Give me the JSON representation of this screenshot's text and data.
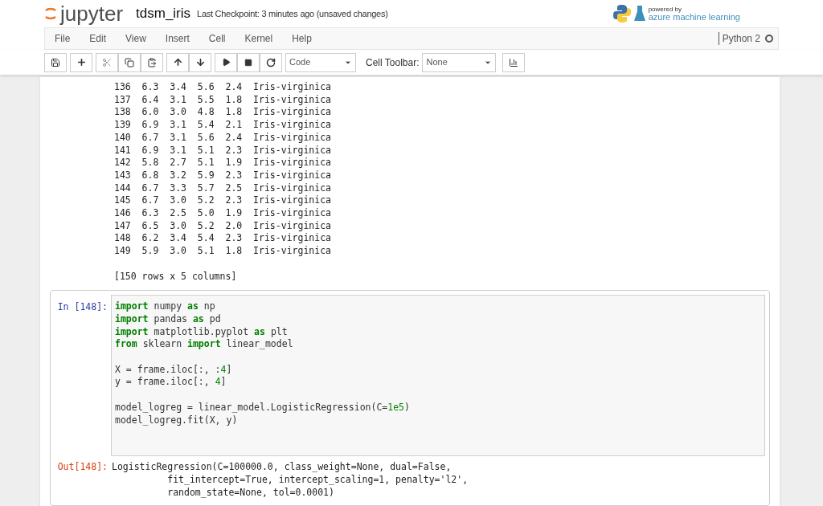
{
  "header": {
    "logo_text": "jupyter",
    "notebook_name": "tdsm_iris",
    "checkpoint": "Last Checkpoint: 3 minutes ago (unsaved changes)",
    "powered_by": "powered by",
    "brand": "azure machine learning"
  },
  "menu": [
    "File",
    "Edit",
    "View",
    "Insert",
    "Cell",
    "Kernel",
    "Help"
  ],
  "kernel": {
    "name": "Python 2",
    "busy": false
  },
  "toolbar": {
    "cell_type": "Code",
    "cell_toolbar_label": "Cell Toolbar:",
    "cell_toolbar_value": "None"
  },
  "output_rows": [
    "136  6.3  3.4  5.6  2.4  Iris-virginica",
    "137  6.4  3.1  5.5  1.8  Iris-virginica",
    "138  6.0  3.0  4.8  1.8  Iris-virginica",
    "139  6.9  3.1  5.4  2.1  Iris-virginica",
    "140  6.7  3.1  5.6  2.4  Iris-virginica",
    "141  6.9  3.1  5.1  2.3  Iris-virginica",
    "142  5.8  2.7  5.1  1.9  Iris-virginica",
    "143  6.8  3.2  5.9  2.3  Iris-virginica",
    "144  6.7  3.3  5.7  2.5  Iris-virginica",
    "145  6.7  3.0  5.2  2.3  Iris-virginica",
    "146  6.3  2.5  5.0  1.9  Iris-virginica",
    "147  6.5  3.0  5.2  2.0  Iris-virginica",
    "148  6.2  3.4  5.4  2.3  Iris-virginica",
    "149  5.9  3.0  5.1  1.8  Iris-virginica"
  ],
  "output_summary": "[150 rows x 5 columns]",
  "cell": {
    "in_prompt": "In [148]:",
    "out_prompt": "Out[148]:",
    "code_blocks": [
      [
        [
          {
            "kind": "keyword",
            "text": "import"
          },
          {
            "kind": "plain",
            "text": " numpy "
          },
          {
            "kind": "keyword",
            "text": "as"
          },
          {
            "kind": "plain",
            "text": " np"
          }
        ],
        [
          {
            "kind": "keyword",
            "text": "import"
          },
          {
            "kind": "plain",
            "text": " pandas "
          },
          {
            "kind": "keyword",
            "text": "as"
          },
          {
            "kind": "plain",
            "text": " pd"
          }
        ],
        [
          {
            "kind": "keyword",
            "text": "import"
          },
          {
            "kind": "plain",
            "text": " matplotlib.pyplot "
          },
          {
            "kind": "keyword",
            "text": "as"
          },
          {
            "kind": "plain",
            "text": " plt"
          }
        ],
        [
          {
            "kind": "keyword",
            "text": "from"
          },
          {
            "kind": "plain",
            "text": " sklearn "
          },
          {
            "kind": "keyword",
            "text": "import"
          },
          {
            "kind": "plain",
            "text": " linear_model"
          }
        ]
      ],
      [
        [
          {
            "kind": "plain",
            "text": "X = frame.iloc[:, :"
          },
          {
            "kind": "number",
            "text": "4"
          },
          {
            "kind": "plain",
            "text": "]"
          }
        ],
        [
          {
            "kind": "plain",
            "text": "y = frame.iloc[:, "
          },
          {
            "kind": "number",
            "text": "4"
          },
          {
            "kind": "plain",
            "text": "]"
          }
        ]
      ],
      [
        [
          {
            "kind": "plain",
            "text": "model_logreg = linear_model.LogisticRegression(C="
          },
          {
            "kind": "number",
            "text": "1e5"
          },
          {
            "kind": "plain",
            "text": ")"
          }
        ],
        [
          {
            "kind": "plain",
            "text": "model_logreg.fit(X, y)"
          }
        ]
      ]
    ],
    "out_lines": [
      "LogisticRegression(C=100000.0, class_weight=None, dual=False,",
      "          fit_intercept=True, intercept_scaling=1, penalty='l2',",
      "          random_state=None, tol=0.0001)"
    ]
  }
}
